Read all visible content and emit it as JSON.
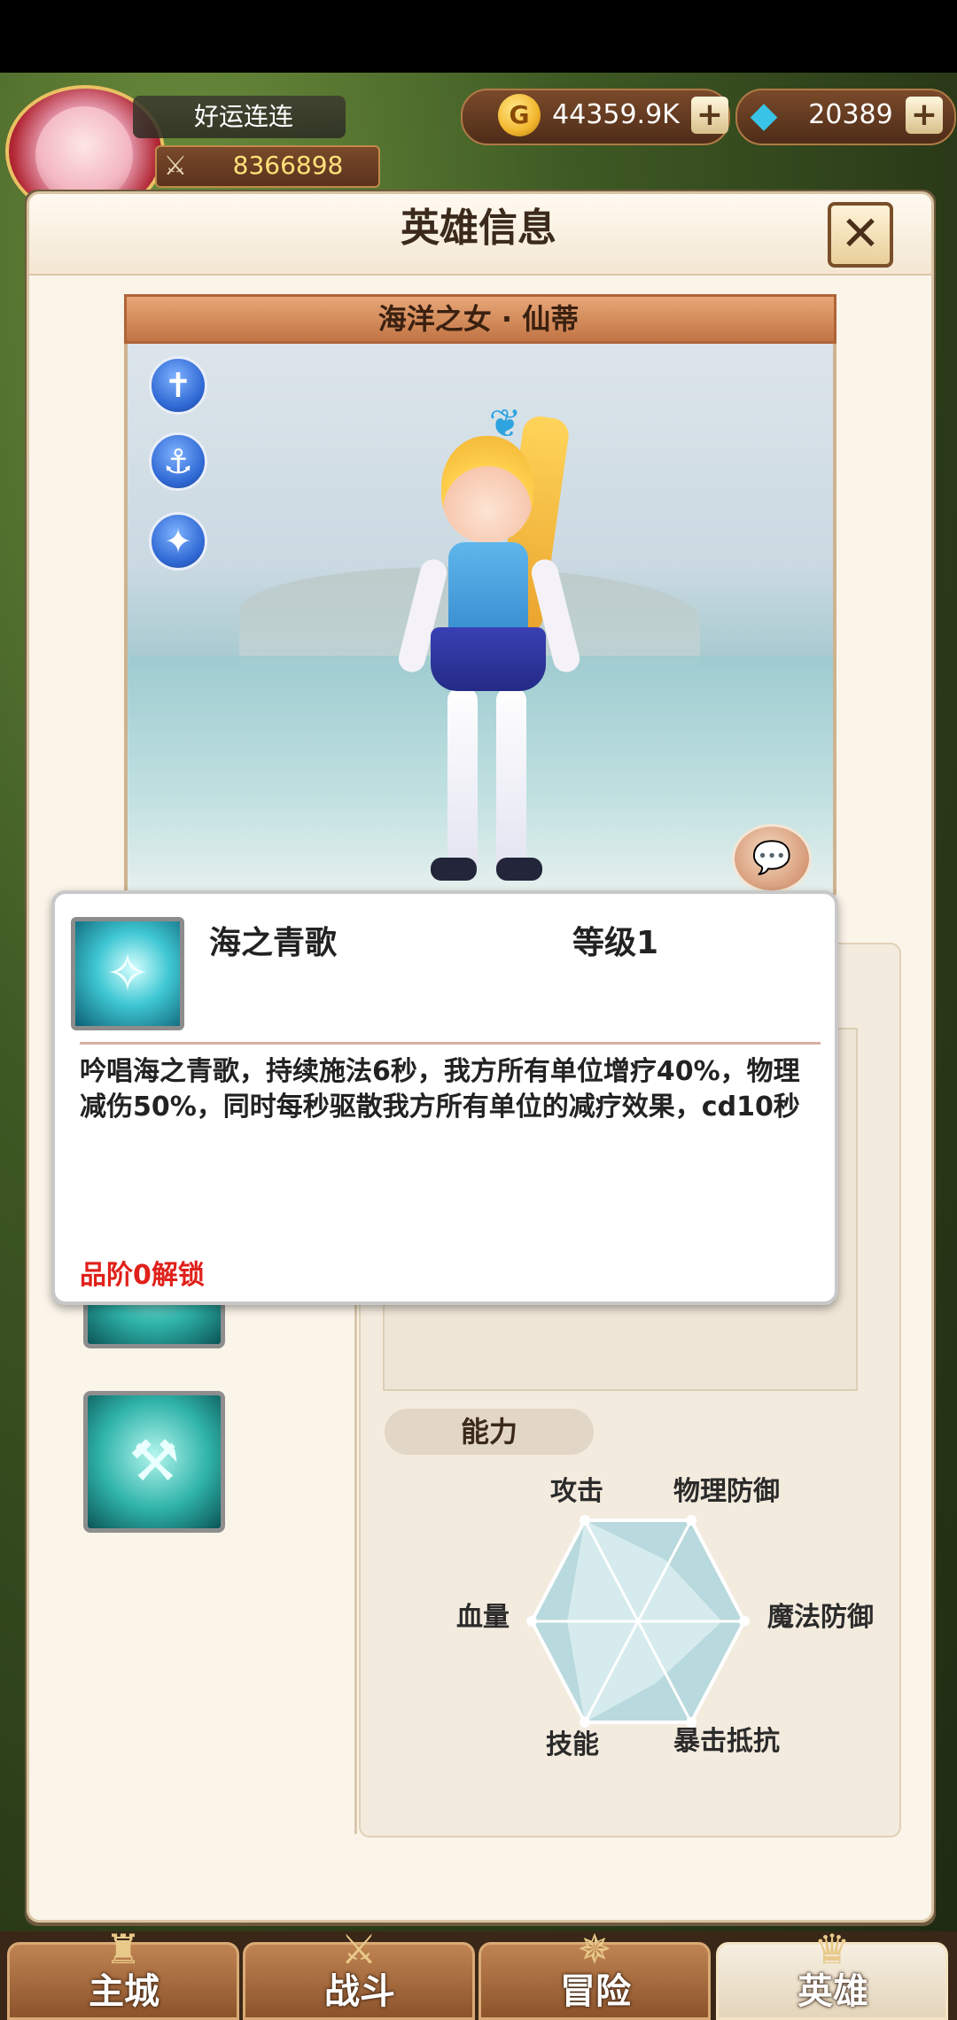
{
  "header": {
    "player_name": "好运连连",
    "power": "8366898",
    "gold": "44359.9K",
    "gems": "20389"
  },
  "panel": {
    "title": "英雄信息",
    "close_label": "✕"
  },
  "hero": {
    "name": "海洋之女 · 仙蒂"
  },
  "skill_popup": {
    "name": "海之青歌",
    "level": "等级1",
    "description": "吟唱海之青歌，持续施法6秒，我方所有单位增疗40%，物理减伤50%，同时每秒驱散我方所有单位的减疗效果，cd10秒",
    "unlock": "品阶0解锁"
  },
  "ability": {
    "section_label": "能力",
    "stats": {
      "attack": "攻击",
      "physical_defense": "物理防御",
      "magic_defense": "魔法防御",
      "crit_resist": "暴击抵抗",
      "skill": "技能",
      "hp": "血量"
    }
  },
  "bottom_nav": {
    "tabs": [
      "主城",
      "战斗",
      "冒险",
      "英雄"
    ],
    "active": "英雄"
  }
}
